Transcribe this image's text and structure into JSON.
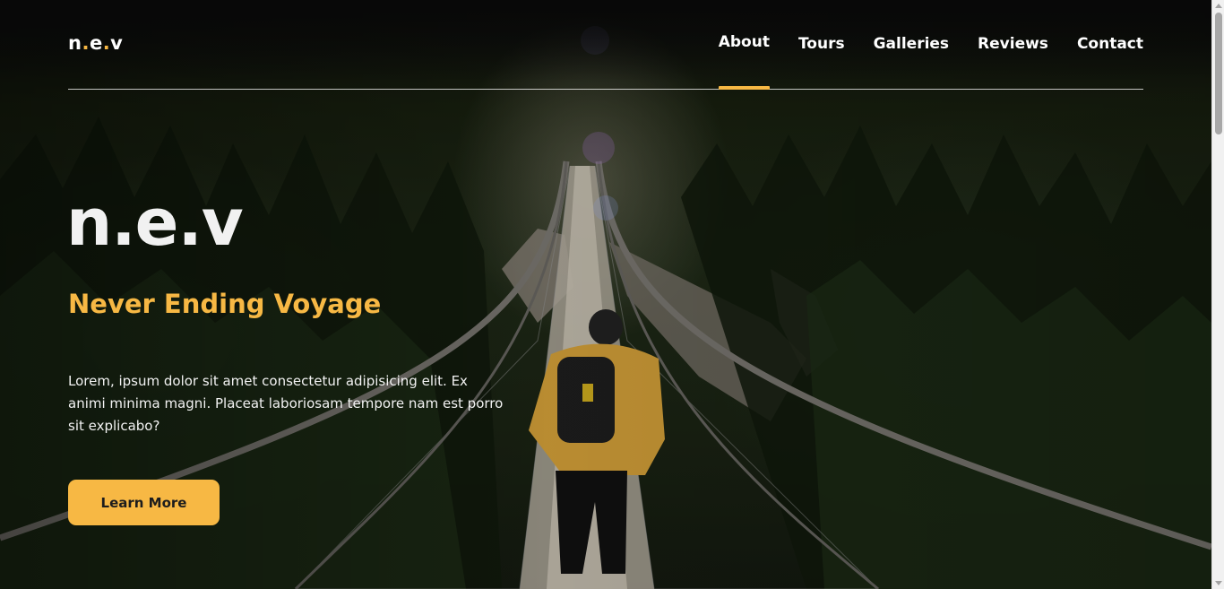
{
  "header": {
    "logo_prefix": "n",
    "logo_dot1": ".",
    "logo_mid": "e",
    "logo_dot2": ".",
    "logo_suffix": "v",
    "nav": [
      {
        "label": "About",
        "active": true
      },
      {
        "label": "Tours",
        "active": false
      },
      {
        "label": "Galleries",
        "active": false
      },
      {
        "label": "Reviews",
        "active": false
      },
      {
        "label": "Contact",
        "active": false
      }
    ]
  },
  "hero": {
    "brand": "n.e.v",
    "tagline": "Never Ending Voyage",
    "description": "Lorem, ipsum dolor sit amet consectetur adipisicing elit. Ex animi minima magni. Placeat laboriosam tempore nam est porro sit explicabo?",
    "cta_label": "Learn More",
    "background_icon": "suspension-bridge-hiker-photo"
  },
  "colors": {
    "accent": "#f7b844",
    "text": "#ffffff",
    "cta_text": "#1d1d1d"
  }
}
